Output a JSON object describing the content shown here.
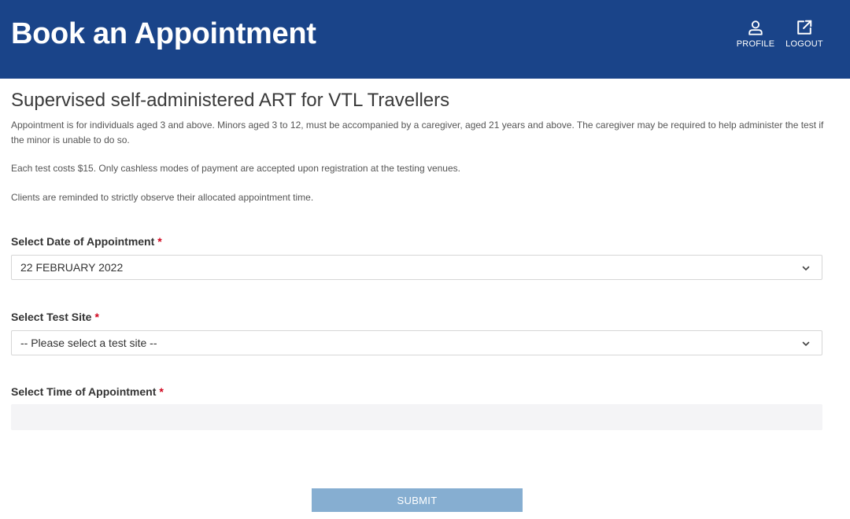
{
  "header": {
    "title": "Book an Appointment",
    "profile_label": "PROFILE",
    "logout_label": "LOGOUT"
  },
  "main": {
    "heading": "Supervised self-administered ART for VTL Travellers",
    "paragraphs": [
      "Appointment is for individuals aged 3 and above. Minors aged 3 to 12, must be accompanied by a caregiver, aged 21 years and above. The caregiver may be required to help administer the test if the minor is unable to do so.",
      "Each test costs $15. Only cashless modes of payment are accepted upon registration at the testing venues.",
      "Clients are reminded to strictly observe their allocated appointment time."
    ]
  },
  "form": {
    "date": {
      "label": "Select Date of Appointment",
      "required_mark": "*",
      "value": "22 FEBRUARY 2022"
    },
    "site": {
      "label": "Select Test Site",
      "required_mark": "*",
      "value": "-- Please select a test site --"
    },
    "time": {
      "label": "Select Time of Appointment",
      "required_mark": "*"
    },
    "submit_label": "SUBMIT"
  },
  "icons": {
    "profile": "user-icon",
    "logout": "external-link-icon",
    "dropdown": "chevron-down-icon"
  },
  "colors": {
    "header_bg": "#1a4489",
    "required": "#d0021b",
    "submit_bg": "#86aed1"
  }
}
